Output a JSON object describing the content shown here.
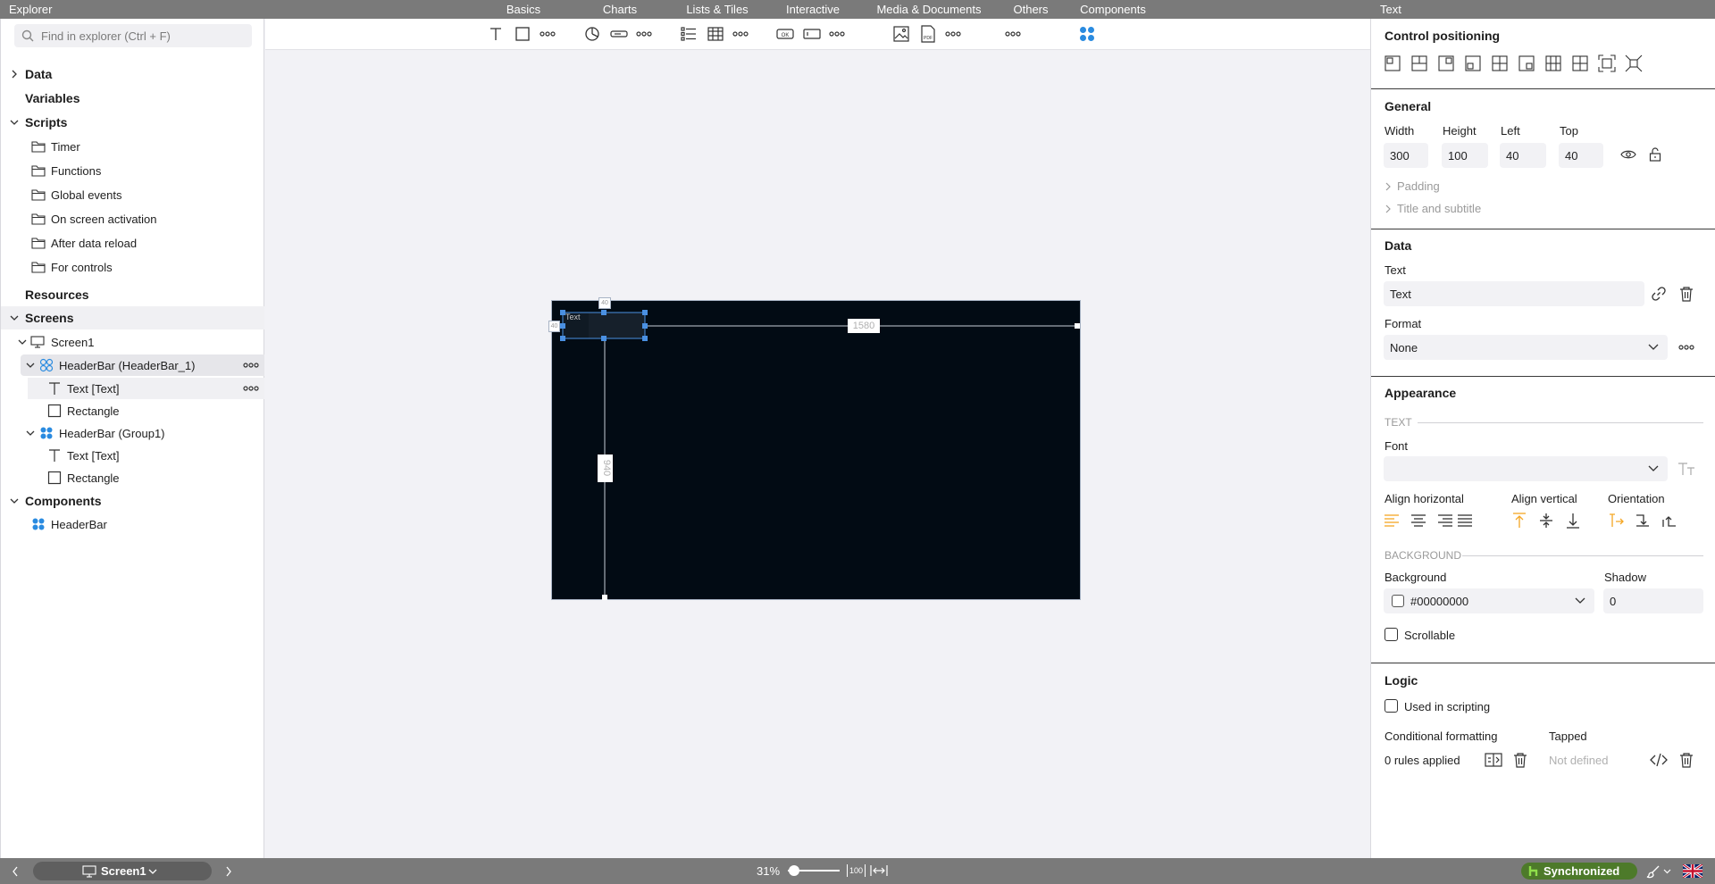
{
  "topbar": {
    "title": "Explorer",
    "categories": [
      "Basics",
      "Charts",
      "Lists & Tiles",
      "Interactive",
      "Media & Documents",
      "Others",
      "Components"
    ],
    "right_title": "Text"
  },
  "explorer": {
    "search_placeholder": "Find in explorer (Ctrl + F)",
    "data_label": "Data",
    "variables_label": "Variables",
    "scripts_label": "Scripts",
    "scripts": [
      "Timer",
      "Functions",
      "Global events",
      "On screen activation",
      "After data reload",
      "For controls"
    ],
    "resources_label": "Resources",
    "screens_label": "Screens",
    "screen1": "Screen1",
    "headerbar1": "HeaderBar (HeaderBar_1)",
    "text1": "Text [Text]",
    "rect1": "Rectangle",
    "headerbar_group": "HeaderBar (Group1)",
    "text2": "Text [Text]",
    "rect2": "Rectangle",
    "components_label": "Components",
    "component_headerbar": "HeaderBar"
  },
  "canvas": {
    "element_text": "Text",
    "width_measure": "1580",
    "height_measure": "940",
    "top_measure": "40",
    "left_measure": "40"
  },
  "properties": {
    "control_positioning": "Control positioning",
    "general": "General",
    "width_label": "Width",
    "height_label": "Height",
    "left_label": "Left",
    "top_label": "Top",
    "width": "300",
    "height": "100",
    "left": "40",
    "top": "40",
    "padding": "Padding",
    "title_subtitle": "Title and subtitle",
    "data": "Data",
    "text_label": "Text",
    "text_value": "Text",
    "format_label": "Format",
    "format_value": "None",
    "appearance": "Appearance",
    "text_group": "TEXT",
    "font_label": "Font",
    "font_value": "",
    "align_horizontal": "Align horizontal",
    "align_vertical": "Align vertical",
    "orientation": "Orientation",
    "background_group": "BACKGROUND",
    "background_label": "Background",
    "background_value": "#00000000",
    "shadow_label": "Shadow",
    "shadow_value": "0",
    "scrollable": "Scrollable",
    "logic": "Logic",
    "used_in_scripting": "Used in scripting",
    "conditional_formatting": "Conditional formatting",
    "tapped": "Tapped",
    "rules_applied": "0 rules applied",
    "not_defined": "Not defined"
  },
  "bottombar": {
    "screen": "Screen1",
    "zoom": "31%",
    "fit_label": "100",
    "sync": "Synchronized"
  },
  "colors": {
    "accent": "#f5a623",
    "selection": "#4a90e2",
    "screen_bg": "#020b14",
    "sync_bg": "#4d7a2a",
    "component_blue": "#2a8be0"
  }
}
